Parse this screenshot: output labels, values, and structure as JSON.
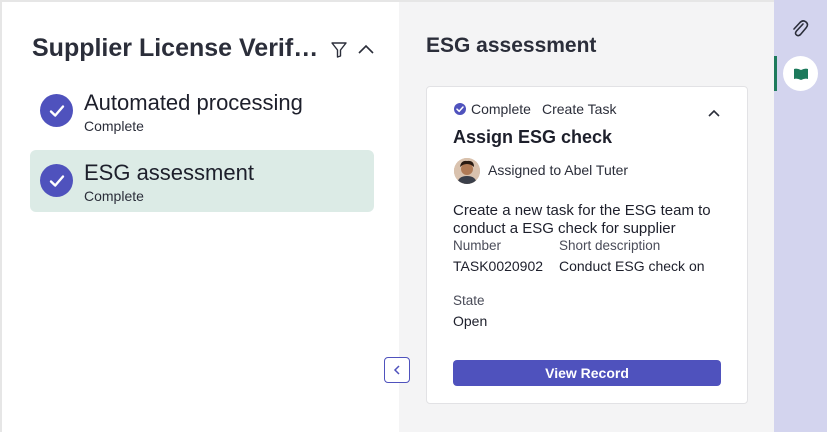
{
  "flow": {
    "title": "Supplier License Verific...",
    "filter_icon": "filter-icon",
    "collapse_icon": "chevron-up-icon",
    "steps": [
      {
        "label": "Automated processing",
        "status": "Complete",
        "active": false
      },
      {
        "label": "ESG assessment",
        "status": "Complete",
        "active": true
      }
    ]
  },
  "detail": {
    "section_title": "ESG assessment",
    "card": {
      "status": "Complete",
      "type": "Create Task",
      "title": "Assign ESG check",
      "assigned_to": "Assigned to Abel Tuter",
      "description": "Create a new task for the ESG team to conduct a ESG check for supplier",
      "fields": {
        "number_label": "Number",
        "number_value": "TASK0020902",
        "short_desc_label": "Short description",
        "short_desc_value": "Conduct ESG check on",
        "state_label": "State",
        "state_value": "Open"
      },
      "button_label": "View Record"
    }
  },
  "rail": {
    "icons": [
      "paperclip-icon",
      "book-icon"
    ]
  },
  "colors": {
    "accent": "#4f52bd",
    "active_step_bg": "#dcebe6",
    "rail_bg": "#d3d4ee",
    "rail_indicator": "#1d7a5c"
  }
}
